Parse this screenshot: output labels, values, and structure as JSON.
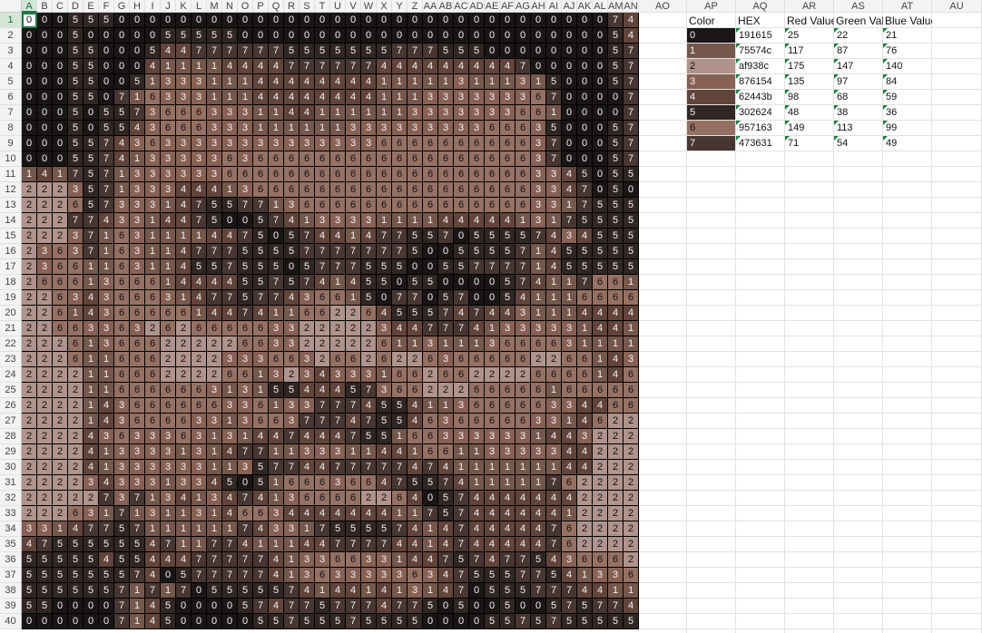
{
  "sheet": {
    "name_box": "A1",
    "col_letters": [
      "A",
      "B",
      "C",
      "D",
      "E",
      "F",
      "G",
      "H",
      "I",
      "J",
      "K",
      "L",
      "M",
      "N",
      "O",
      "P",
      "Q",
      "R",
      "S",
      "T",
      "U",
      "V",
      "W",
      "X",
      "Y",
      "Z",
      "AA",
      "AB",
      "AC",
      "AD",
      "AE",
      "AF",
      "AG",
      "AH",
      "AI",
      "AJ",
      "AK",
      "AL",
      "AM",
      "AN"
    ],
    "extra_cols": [
      "AO",
      "AP",
      "AQ",
      "AR",
      "AS",
      "AT",
      "AU"
    ],
    "row_count": 39
  },
  "palette": {
    "headers": [
      "Color",
      "HEX",
      "Red Value",
      "Green Value",
      "Blue Value"
    ],
    "rows": [
      {
        "id": "0",
        "hex": "191615",
        "r": "25",
        "g": "22",
        "b": "21",
        "color": "#191615"
      },
      {
        "id": "1",
        "hex": "75574c",
        "r": "117",
        "g": "87",
        "b": "76",
        "color": "#75574c"
      },
      {
        "id": "2",
        "hex": "af938c",
        "r": "175",
        "g": "147",
        "b": "140",
        "color": "#af938c"
      },
      {
        "id": "3",
        "hex": "876154",
        "r": "135",
        "g": "97",
        "b": "84",
        "color": "#876154"
      },
      {
        "id": "4",
        "hex": "62443b",
        "r": "98",
        "g": "68",
        "b": "59",
        "color": "#62443b"
      },
      {
        "id": "5",
        "hex": "302624",
        "r": "48",
        "g": "38",
        "b": "36",
        "color": "#302624"
      },
      {
        "id": "6",
        "hex": "957163",
        "r": "149",
        "g": "113",
        "b": "99",
        "color": "#957163"
      },
      {
        "id": "7",
        "hex": "473631",
        "r": "71",
        "g": "54",
        "b": "49",
        "color": "#473631"
      }
    ]
  },
  "pixel_grid": [
    "0005550000000000000000000000000000000074",
    "0005000005555500000000000000000000000054",
    "0005500054477777755555557775550000000057",
    "0005500041111444477777744444444470000057",
    "0005500513331114444444411111311131500057",
    "0005507163331114444444411133333336700007",
    "0005055736663331144111111333333366100007",
    "0005055436663331111113333333336663500057",
    "0005574363333333333333366666666663700057",
    "0005574133333636666666666666666663700057",
    "1417571333333666666666666666666663345055",
    "2223571333444136666666666666666663347050",
    "2226573331475577136666666666666663317555",
    "2227743314475005741333311114444413175555",
    "2223716311114475057441477557055557434555",
    "2363716311477755557777777500555571455555",
    "2366116311455755505777555005577771455555",
    "2666136661444455757414550550000574117661",
    "2263436663147757743661507705700541116666",
    "2261436666614474116622645557474431114444",
    "2266336326266666332222234477741333331441",
    "2226136662222266332222261131113666631111",
    "2226116662222333663266262263666662266143",
    "2222116662222661323433316626622226666146",
    "2222116666663131554445736622266666166666",
    "2222143666666336133777455411366666334466",
    "2222143666633136637774755463666663314622",
    "2222436333631314474447551663333331443222",
    "2222413333131477113331144166113333344222",
    "2222413333331135774477777474111111144222",
    "2222343331334505166636647557411111762222",
    "2222273713413474136666226405744444442222",
    "2226317131131466344444441175744444412222",
    "3314775711111174331755557414744444762222",
    "4755555547117741114477774414744444762222",
    "5555545544477777413366331447574775436662",
    "5555555740577777413633333634755577541336",
    "5555557171705555574144141314705557774411",
    "5500007145000057477577747750500500575774",
    "0000007145000005575557555500005575755555"
  ],
  "value_colors": {
    "0": "#191615",
    "1": "#75574c",
    "2": "#af938c",
    "3": "#876154",
    "4": "#62443b",
    "5": "#302624",
    "6": "#957163",
    "7": "#473631"
  }
}
